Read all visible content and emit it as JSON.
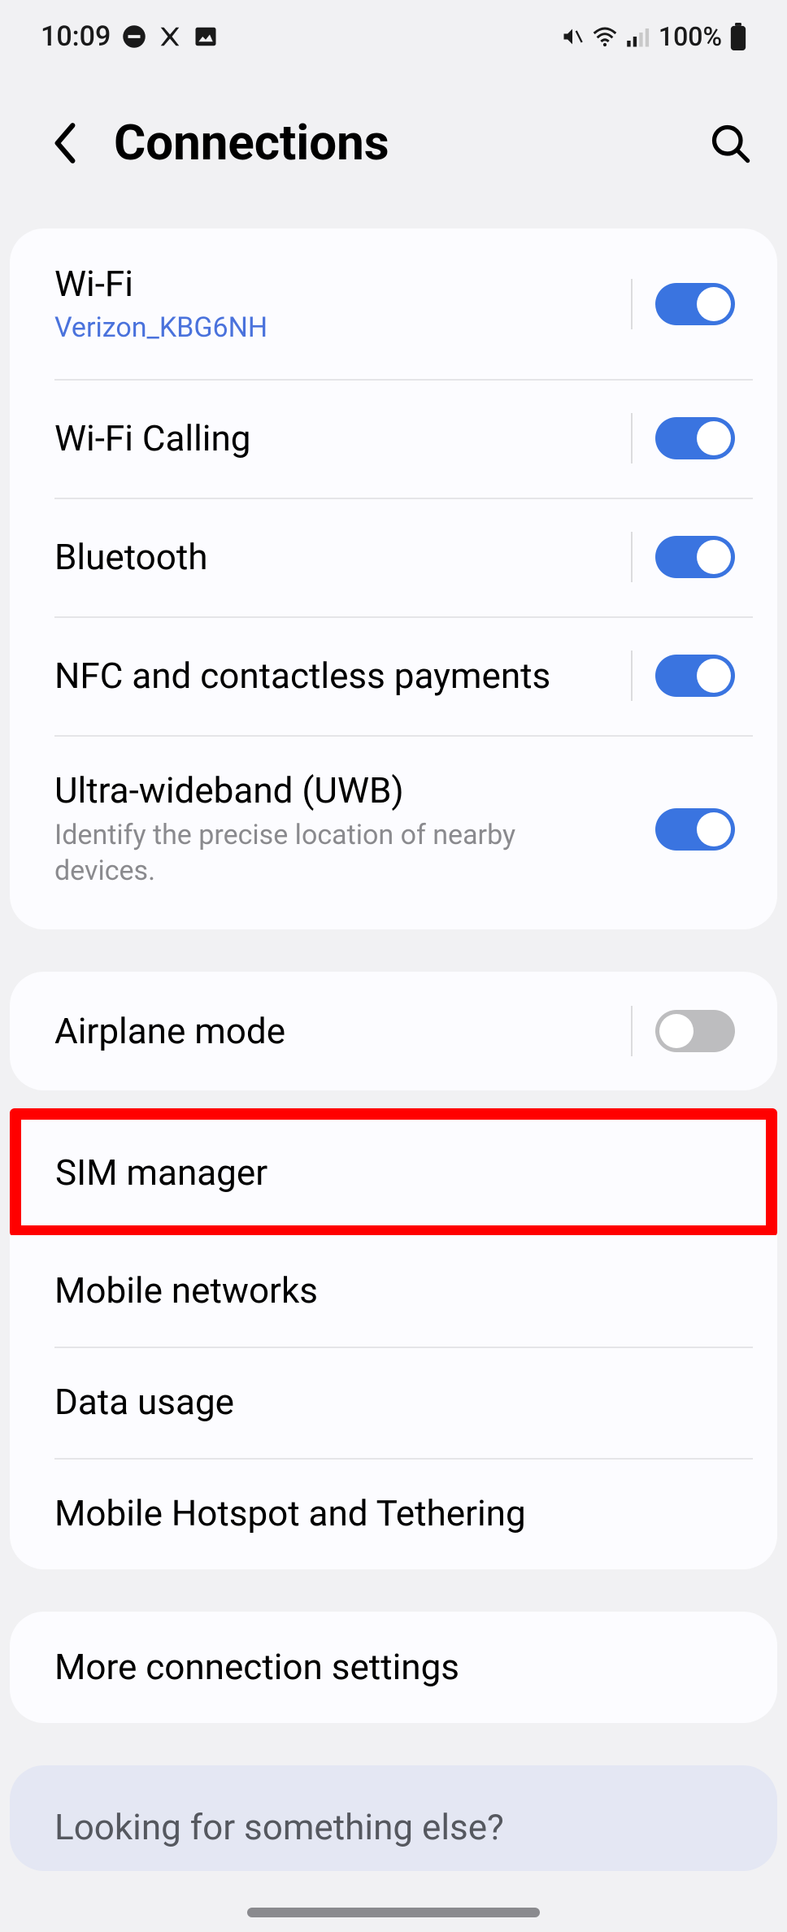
{
  "status": {
    "time": "10:09",
    "battery": "100%"
  },
  "header": {
    "title": "Connections"
  },
  "group1": {
    "wifi": {
      "title": "Wi-Fi",
      "network": "Verizon_KBG6NH",
      "on": true
    },
    "wifiCalling": {
      "title": "Wi-Fi Calling",
      "on": true
    },
    "bluetooth": {
      "title": "Bluetooth",
      "on": true
    },
    "nfc": {
      "title": "NFC and contactless payments",
      "on": true
    },
    "uwb": {
      "title": "Ultra-wideband (UWB)",
      "desc": "Identify the precise location of nearby devices.",
      "on": true
    }
  },
  "group2": {
    "airplane": {
      "title": "Airplane mode",
      "on": false
    }
  },
  "group3": {
    "sim": {
      "title": "SIM manager"
    },
    "mobileNetworks": {
      "title": "Mobile networks"
    },
    "dataUsage": {
      "title": "Data usage"
    },
    "hotspot": {
      "title": "Mobile Hotspot and Tethering"
    }
  },
  "group4": {
    "more": {
      "title": "More connection settings"
    }
  },
  "suggestion": {
    "title": "Looking for something else?"
  }
}
